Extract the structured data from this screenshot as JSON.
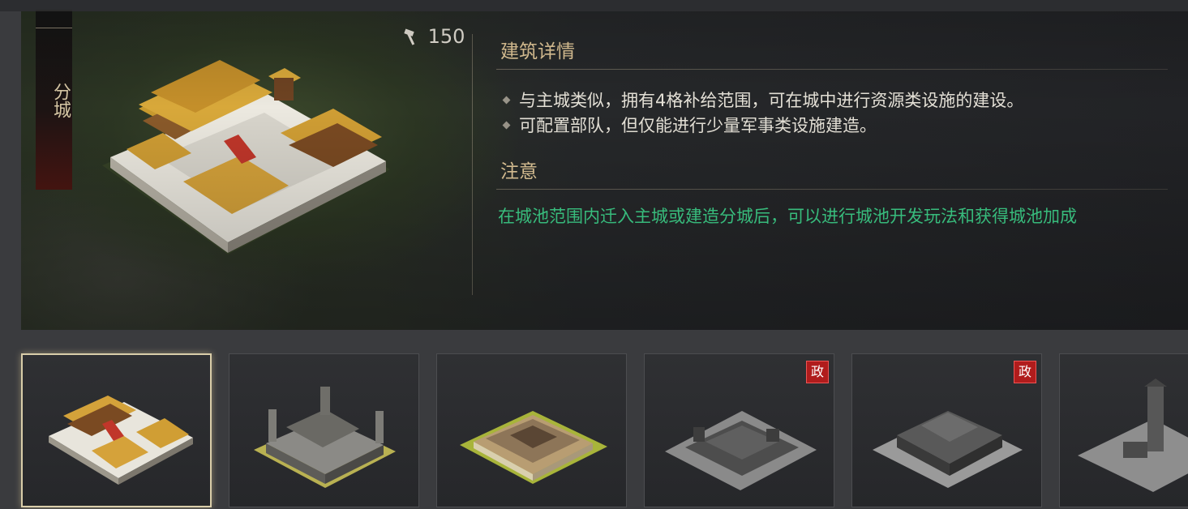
{
  "building": {
    "name": "分城",
    "cost": "150",
    "cost_icon": "hammer-icon"
  },
  "details": {
    "title": "建筑详情",
    "bullets": [
      "与主城类似，拥有4格补给范围，可在城中进行资源类设施的建设。",
      "可配置部队，但仅能进行少量军事类设施建造。"
    ]
  },
  "notice": {
    "title": "注意",
    "text": "在城池范围内迁入主城或建造分城后，可以进行城池开发玩法和获得城池加成",
    "color": "#3fd58d"
  },
  "cards": [
    {
      "kind": "golden-palace",
      "selected": true,
      "badge": ""
    },
    {
      "kind": "stone-fortress",
      "selected": false,
      "badge": ""
    },
    {
      "kind": "walled-town",
      "selected": false,
      "badge": ""
    },
    {
      "kind": "grey-camp",
      "selected": false,
      "badge": "政"
    },
    {
      "kind": "grey-fortress",
      "selected": false,
      "badge": "政"
    },
    {
      "kind": "grey-tower",
      "selected": false,
      "badge": ""
    }
  ],
  "colors": {
    "accent_gold": "#e3c99a",
    "notice_green": "#3fd58d",
    "badge_red": "#b01c1c"
  }
}
